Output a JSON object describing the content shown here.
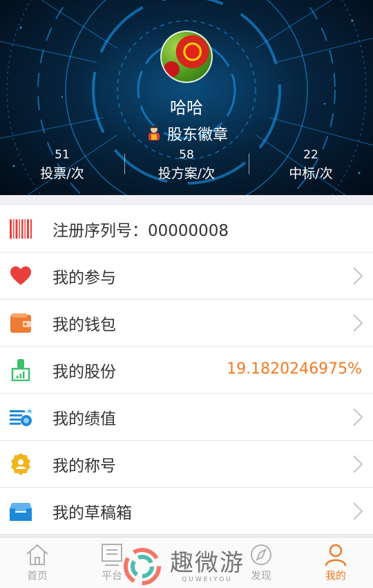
{
  "profile": {
    "username": "哈哈",
    "badge_label": "股东徽章",
    "stats": [
      {
        "value": "51",
        "label": "投票/次"
      },
      {
        "value": "58",
        "label": "投方案/次"
      },
      {
        "value": "22",
        "label": "中标/次"
      }
    ]
  },
  "menu": {
    "serial_label": "注册序列号：00000008",
    "participation": "我的参与",
    "wallet": "我的钱包",
    "shares": "我的股份",
    "shares_value": "19.1820246975%",
    "performance": "我的绩值",
    "title": "我的称号",
    "drafts": "我的草稿箱"
  },
  "tabbar": {
    "home": "首页",
    "platform": "平台",
    "discover": "发现",
    "mine": "我的"
  },
  "watermark": {
    "text": "趣微游",
    "sub": "QUWEIYOU"
  },
  "colors": {
    "accent": "#f07a22",
    "heart": "#e8413c",
    "wallet": "#ee7b33",
    "shares": "#3cc06a",
    "performance": "#1e88d9",
    "title_badge": "#f2b31b",
    "drafts": "#1e88d9",
    "barcode": "#e8413c"
  },
  "icons": {
    "serial": "barcode-icon",
    "participation": "heart-icon",
    "wallet": "wallet-icon",
    "shares": "stock-certificate-icon",
    "performance": "performance-chart-icon",
    "title": "medal-icon",
    "drafts": "inbox-tray-icon"
  }
}
